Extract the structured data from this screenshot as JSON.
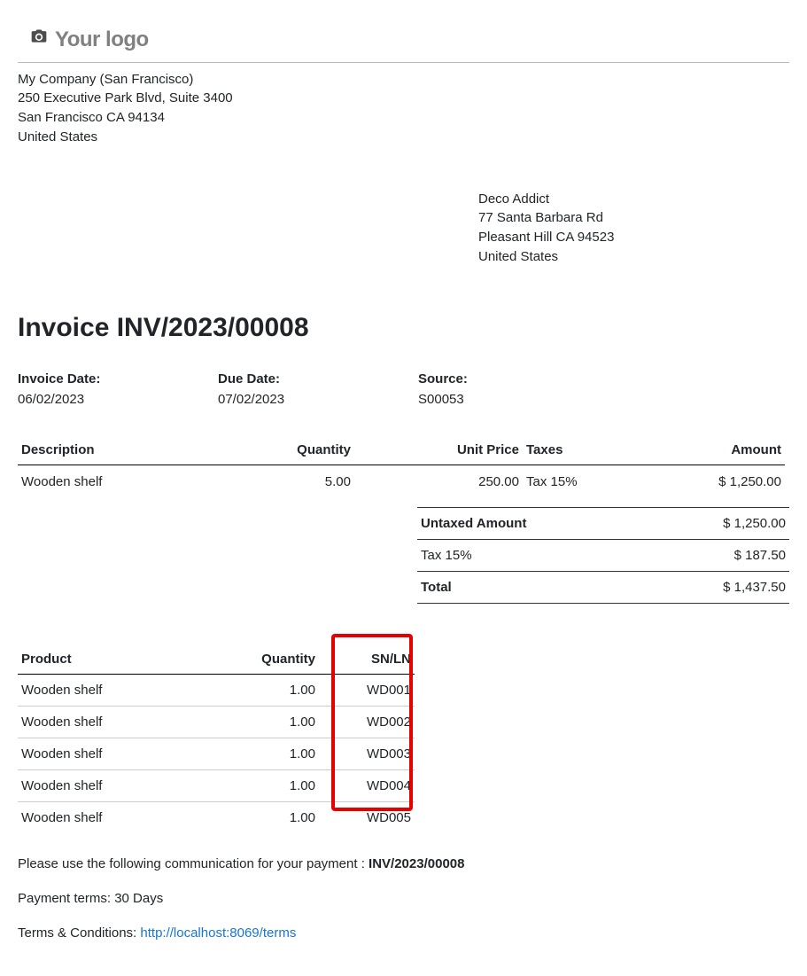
{
  "logo": {
    "placeholder": "Your logo"
  },
  "company": {
    "name": "My Company (San Francisco)",
    "street": "250 Executive Park Blvd, Suite 3400",
    "city_line": "San Francisco CA 94134",
    "country": "United States"
  },
  "client": {
    "name": "Deco Addict",
    "street": "77 Santa Barbara Rd",
    "city_line": "Pleasant Hill CA 94523",
    "country": "United States"
  },
  "doc_title": "Invoice INV/2023/00008",
  "meta": {
    "invoice_date": {
      "label": "Invoice Date:",
      "value": "06/02/2023"
    },
    "due_date": {
      "label": "Due Date:",
      "value": "07/02/2023"
    },
    "source": {
      "label": "Source:",
      "value": "S00053"
    }
  },
  "lines": {
    "headers": {
      "description": "Description",
      "quantity": "Quantity",
      "unit_price": "Unit Price",
      "taxes": "Taxes",
      "amount": "Amount"
    },
    "rows": [
      {
        "description": "Wooden shelf",
        "quantity": "5.00",
        "unit_price": "250.00",
        "taxes": "Tax 15%",
        "amount": "$ 1,250.00"
      }
    ]
  },
  "totals": {
    "untaxed": {
      "label": "Untaxed Amount",
      "value": "$ 1,250.00"
    },
    "tax": {
      "label": "Tax 15%",
      "value": "$ 187.50"
    },
    "total": {
      "label": "Total",
      "value": "$ 1,437.50"
    }
  },
  "snln": {
    "headers": {
      "product": "Product",
      "quantity": "Quantity",
      "snln": "SN/LN"
    },
    "rows": [
      {
        "product": "Wooden shelf",
        "quantity": "1.00",
        "snln": "WD001"
      },
      {
        "product": "Wooden shelf",
        "quantity": "1.00",
        "snln": "WD002"
      },
      {
        "product": "Wooden shelf",
        "quantity": "1.00",
        "snln": "WD003"
      },
      {
        "product": "Wooden shelf",
        "quantity": "1.00",
        "snln": "WD004"
      },
      {
        "product": "Wooden shelf",
        "quantity": "1.00",
        "snln": "WD005"
      }
    ]
  },
  "footnotes": {
    "communication_prefix": "Please use the following communication for your payment : ",
    "communication_ref": "INV/2023/00008",
    "payment_terms": "Payment terms: 30 Days",
    "terms_prefix": "Terms & Conditions: ",
    "terms_url": "http://localhost:8069/terms"
  }
}
